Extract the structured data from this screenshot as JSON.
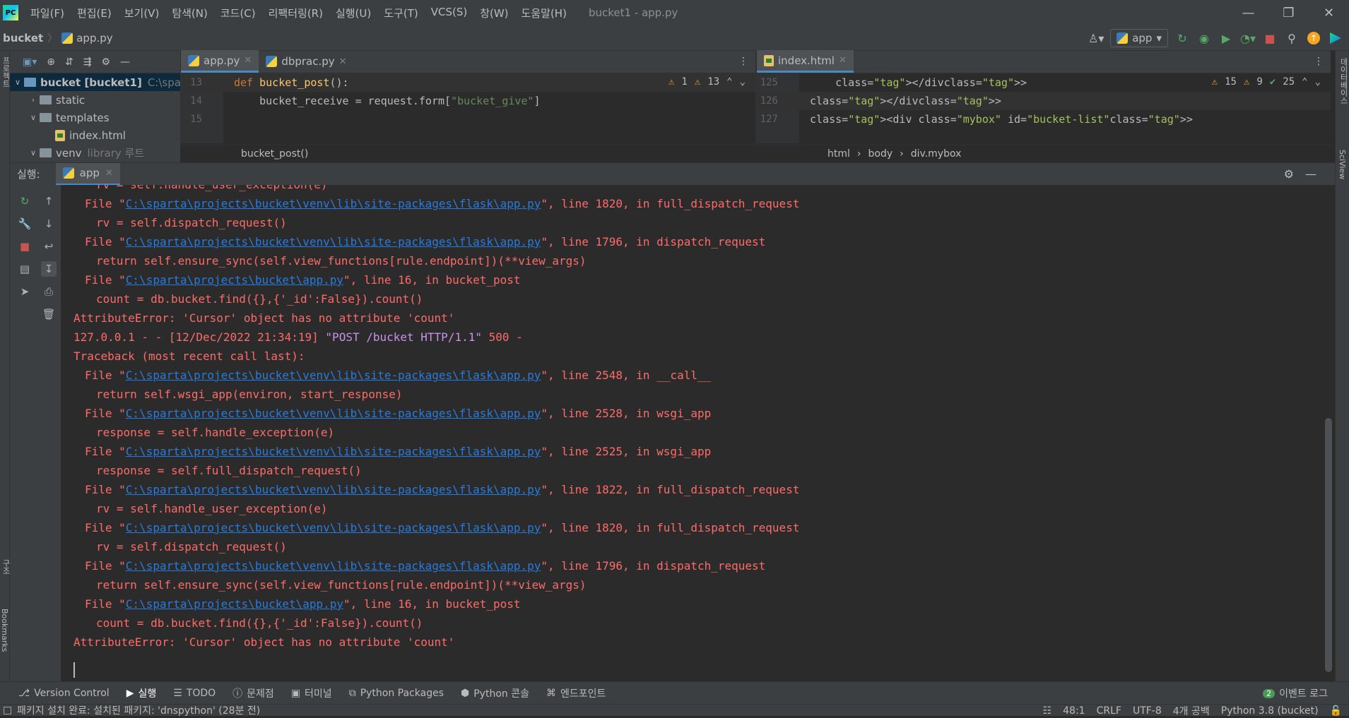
{
  "app": {
    "logo": "PC",
    "window_title": "bucket1 - app.py"
  },
  "menu": [
    "파일(F)",
    "편집(E)",
    "보기(V)",
    "탐색(N)",
    "코드(C)",
    "리팩터링(R)",
    "실행(U)",
    "도구(T)",
    "VCS(S)",
    "창(W)",
    "도움말(H)"
  ],
  "nav": {
    "project": "bucket",
    "file": "app.py",
    "run_config": "app"
  },
  "left_strip": {
    "project_label": "프로젝트",
    "structure_label": "구조",
    "bookmarks_label": "Bookmarks"
  },
  "right_strip": {
    "database_label": "데이터베이스",
    "sciview_label": "SciView"
  },
  "project_tree": [
    {
      "label": "bucket [bucket1]",
      "hint": "C:\\sparta",
      "level": 0,
      "type": "root",
      "expanded": true
    },
    {
      "label": "static",
      "hint": "",
      "level": 1,
      "type": "folder",
      "expanded": false
    },
    {
      "label": "templates",
      "hint": "",
      "level": 1,
      "type": "folder",
      "expanded": true
    },
    {
      "label": "index.html",
      "hint": "",
      "level": 2,
      "type": "file",
      "expanded": false
    },
    {
      "label": "venv",
      "hint": "library 루트",
      "level": 1,
      "type": "folder",
      "expanded": true
    }
  ],
  "editor_left": {
    "tabs": [
      {
        "label": "app.py",
        "active": true
      },
      {
        "label": "dbprac.py",
        "active": false
      }
    ],
    "lines": [
      {
        "num": "13",
        "code": "def bucket_post():"
      },
      {
        "num": "14",
        "code": "    bucket_receive = request.form[\"bucket_give\"]"
      },
      {
        "num": "15",
        "code": ""
      }
    ],
    "warnings": "1",
    "weak_warnings": "13",
    "breadcrumb": "bucket_post()"
  },
  "editor_right": {
    "tabs": [
      {
        "label": "index.html",
        "active": true
      }
    ],
    "lines": [
      {
        "num": "125",
        "code": "    </div>"
      },
      {
        "num": "126",
        "code": "</div>"
      },
      {
        "num": "127",
        "code": "<div class=\"mybox\" id=\"bucket-list\">"
      }
    ],
    "warnings": "15",
    "weak_warnings": "9",
    "ok": "25",
    "breadcrumbs": [
      "html",
      "body",
      "div.mybox"
    ]
  },
  "run_panel": {
    "label": "실행:",
    "tab": "app"
  },
  "console_lines": [
    {
      "indent": 2,
      "pre": "rv = self.handle_user_exception(e)",
      "link": "",
      "post": ""
    },
    {
      "indent": 1,
      "pre": "File \"",
      "link": "C:\\sparta\\projects\\bucket\\venv\\lib\\site-packages\\flask\\app.py",
      "post": "\", line 1820, in full_dispatch_request"
    },
    {
      "indent": 2,
      "pre": "rv = self.dispatch_request()",
      "link": "",
      "post": ""
    },
    {
      "indent": 1,
      "pre": "File \"",
      "link": "C:\\sparta\\projects\\bucket\\venv\\lib\\site-packages\\flask\\app.py",
      "post": "\", line 1796, in dispatch_request"
    },
    {
      "indent": 2,
      "pre": "return self.ensure_sync(self.view_functions[rule.endpoint])(**view_args)",
      "link": "",
      "post": ""
    },
    {
      "indent": 1,
      "pre": "File \"",
      "link": "C:\\sparta\\projects\\bucket\\app.py",
      "post": "\", line 16, in bucket_post"
    },
    {
      "indent": 2,
      "pre": "count = db.bucket.find({},{'_id':False}).count()",
      "link": "",
      "post": ""
    },
    {
      "indent": 0,
      "pre": "AttributeError: 'Cursor' object has no attribute 'count'",
      "link": "",
      "post": ""
    },
    {
      "indent": 0,
      "pre": "127.0.0.1 - - [12/Dec/2022 21:34:19] ",
      "link": "",
      "post": "",
      "req": "\"POST /bucket HTTP/1.1\"",
      "tail": " 500 -"
    },
    {
      "indent": 0,
      "pre": "Traceback (most recent call last):",
      "link": "",
      "post": ""
    },
    {
      "indent": 1,
      "pre": "File \"",
      "link": "C:\\sparta\\projects\\bucket\\venv\\lib\\site-packages\\flask\\app.py",
      "post": "\", line 2548, in __call__"
    },
    {
      "indent": 2,
      "pre": "return self.wsgi_app(environ, start_response)",
      "link": "",
      "post": ""
    },
    {
      "indent": 1,
      "pre": "File \"",
      "link": "C:\\sparta\\projects\\bucket\\venv\\lib\\site-packages\\flask\\app.py",
      "post": "\", line 2528, in wsgi_app"
    },
    {
      "indent": 2,
      "pre": "response = self.handle_exception(e)",
      "link": "",
      "post": ""
    },
    {
      "indent": 1,
      "pre": "File \"",
      "link": "C:\\sparta\\projects\\bucket\\venv\\lib\\site-packages\\flask\\app.py",
      "post": "\", line 2525, in wsgi_app"
    },
    {
      "indent": 2,
      "pre": "response = self.full_dispatch_request()",
      "link": "",
      "post": ""
    },
    {
      "indent": 1,
      "pre": "File \"",
      "link": "C:\\sparta\\projects\\bucket\\venv\\lib\\site-packages\\flask\\app.py",
      "post": "\", line 1822, in full_dispatch_request"
    },
    {
      "indent": 2,
      "pre": "rv = self.handle_user_exception(e)",
      "link": "",
      "post": ""
    },
    {
      "indent": 1,
      "pre": "File \"",
      "link": "C:\\sparta\\projects\\bucket\\venv\\lib\\site-packages\\flask\\app.py",
      "post": "\", line 1820, in full_dispatch_request"
    },
    {
      "indent": 2,
      "pre": "rv = self.dispatch_request()",
      "link": "",
      "post": ""
    },
    {
      "indent": 1,
      "pre": "File \"",
      "link": "C:\\sparta\\projects\\bucket\\venv\\lib\\site-packages\\flask\\app.py",
      "post": "\", line 1796, in dispatch_request"
    },
    {
      "indent": 2,
      "pre": "return self.ensure_sync(self.view_functions[rule.endpoint])(**view_args)",
      "link": "",
      "post": ""
    },
    {
      "indent": 1,
      "pre": "File \"",
      "link": "C:\\sparta\\projects\\bucket\\app.py",
      "post": "\", line 16, in bucket_post"
    },
    {
      "indent": 2,
      "pre": "count = db.bucket.find({},{'_id':False}).count()",
      "link": "",
      "post": ""
    },
    {
      "indent": 0,
      "pre": "AttributeError: 'Cursor' object has no attribute 'count'",
      "link": "",
      "post": ""
    }
  ],
  "bottom_tools": [
    {
      "label": "Version Control",
      "icon": "version-control-icon"
    },
    {
      "label": "실행",
      "icon": "run-icon",
      "active": true
    },
    {
      "label": "TODO",
      "icon": "todo-icon"
    },
    {
      "label": "문제점",
      "icon": "problems-icon"
    },
    {
      "label": "터미널",
      "icon": "terminal-icon"
    },
    {
      "label": "Python Packages",
      "icon": "packages-icon"
    },
    {
      "label": "Python 콘솔",
      "icon": "python-console-icon"
    },
    {
      "label": "엔드포인트",
      "icon": "endpoints-icon"
    }
  ],
  "events": {
    "count": "2",
    "label": "이벤트 로그"
  },
  "status": {
    "message": "패키지 설치 완료: 설치된 패키지: 'dnspython' (28분 전)",
    "position": "48:1",
    "line_sep": "CRLF",
    "encoding": "UTF-8",
    "indent": "4개 공백",
    "interpreter": "Python 3.8 (bucket)"
  },
  "colors": {
    "error": "#ff6b68",
    "link": "#287bde",
    "accent": "#4a88c7"
  }
}
